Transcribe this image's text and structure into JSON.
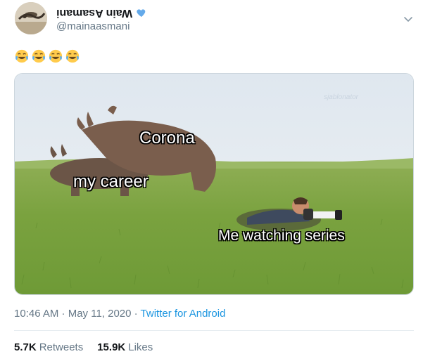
{
  "tweet": {
    "display_name": "Wain Asamani",
    "handle": "@mainaasmani",
    "text_emojis": [
      "😂",
      "😂",
      "😂",
      "😂"
    ],
    "timestamp": "10:46 AM · May 11, 2020 · ",
    "source": "Twitter for Android",
    "retweets_count": "5.7K",
    "retweets_label": "Retweets",
    "likes_count": "15.9K",
    "likes_label": "Likes",
    "verified_color": "#1da1f2",
    "accent_color": "#1b95e0"
  },
  "media": {
    "label_top": "Corona",
    "label_left": "my career",
    "label_right": "Me watching series",
    "watermark": "sjablonator"
  },
  "icons": {
    "verified": "verified-badge-icon",
    "menu": "chevron-down-icon",
    "emoji": "face-with-tears-of-joy-icon"
  }
}
